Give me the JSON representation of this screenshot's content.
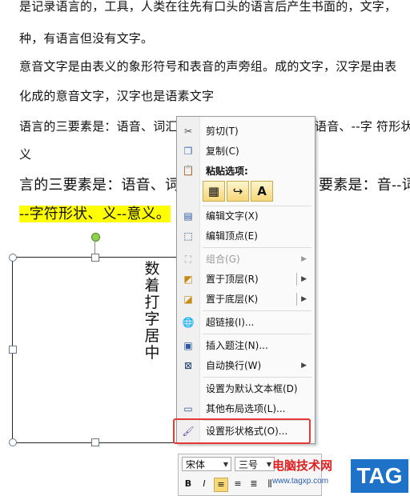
{
  "document": {
    "lines": [
      "是记录语言的，工具，人类在往先有口头的语言后产生书面的，文字，",
      "种，有语言但没有文字。",
      "意音文字是由表义的象形符号和表音的声旁组。成的文字，汉字是由表",
      "化成的意音文字，汉字也是语素文字",
      "语言的三要素是：语音、词汇",
      "义",
      "言的三要素是：语音、词",
      "--字符形状、义--意义。",
      "语音、--字  符形状",
      "要素是：音--词"
    ],
    "textbox_text": "数着打字居中"
  },
  "context_menu": {
    "cut": "剪切(T)",
    "copy": "复制(C)",
    "paste_options": "粘贴选项:",
    "edit_text": "编辑文字(X)",
    "edit_points": "编辑顶点(E)",
    "group": "组合(G)",
    "bring_to_front": "置于顶层(R)",
    "send_to_back": "置于底层(K)",
    "hyperlink": "超链接(I)...",
    "insert_caption": "插入题注(N)...",
    "wrap_text": "自动换行(W)",
    "set_default_textbox": "设置为默认文本框(D)",
    "more_layout": "其他布局选项(L)...",
    "format_shape": "设置形状格式(O)..."
  },
  "mini_toolbar": {
    "font": "宋体",
    "size": "三号"
  },
  "watermark": {
    "site_name": "电脑技术网",
    "url": "www.tagxp.com",
    "tag": "TAG"
  },
  "colors": {
    "highlight": "#ffff00",
    "format_shape_box": "#e53935",
    "tag_bg": "#1e73c8"
  }
}
